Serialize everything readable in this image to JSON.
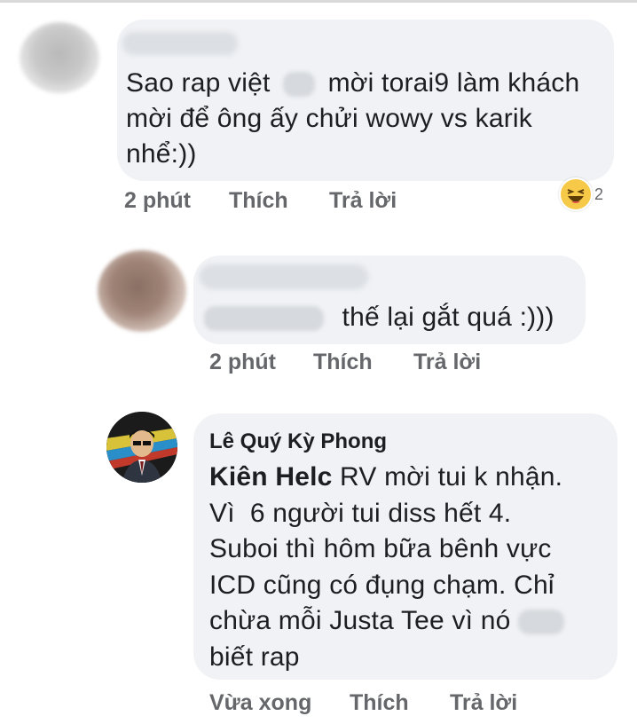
{
  "comments": [
    {
      "text_before": "Sao rap việt",
      "text_after": "mời torai9 làm khách",
      "line2": "mời để ông ấy chửi wowy vs karik",
      "line3": "nhể:))",
      "time": "2 phút",
      "like_label": "Thích",
      "reply_label": "Trả lời",
      "reaction_icon": "haha-emoji-icon",
      "reaction_count": "2"
    },
    {
      "text": "thế lại gắt quá :)))",
      "time": "2 phút",
      "like_label": "Thích",
      "reply_label": "Trả lời"
    },
    {
      "author": "Lê Quý Kỳ Phong",
      "mention": "Kiên Helc",
      "line1_rest": " RV mời tui k nhận.",
      "line2": "Vì  6 người tui diss hết 4.",
      "line3": "Suboi thì hôm bữa bênh vực",
      "line4": "ICD cũng có đụng chạm. Chỉ",
      "line5": "chừa mỗi Justa Tee vì nó",
      "line6": "biết rap",
      "time": "Vừa xong",
      "like_label": "Thích",
      "reply_label": "Trả lời"
    }
  ],
  "colors": {
    "bubble": "#f0f2f5",
    "meta": "#65676b",
    "text": "#1c1e21"
  }
}
